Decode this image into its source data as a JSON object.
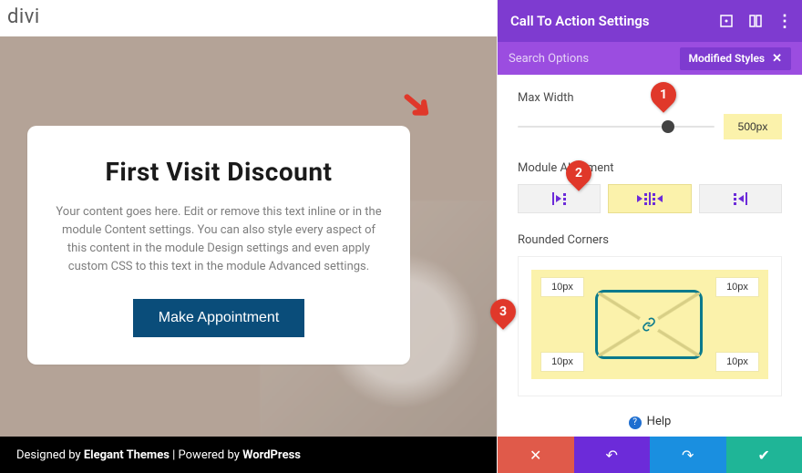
{
  "logo": "divi",
  "card": {
    "title": "First Visit Discount",
    "body": "Your content goes here. Edit or remove this text inline or in the module Content settings. You can also style every aspect of this content in the module Design settings and even apply custom CSS to this text in the module Advanced settings.",
    "button": "Make Appointment"
  },
  "footer": {
    "prefix": "Designed by ",
    "brand": "Elegant Themes",
    "mid": " | Powered by ",
    "platform": "WordPress"
  },
  "panel": {
    "title": "Call To Action Settings",
    "search_label": "Search Options",
    "pill": "Modified Styles",
    "max_width": {
      "label": "Max Width",
      "value": "500px"
    },
    "alignment": {
      "label": "Module Alignment",
      "selected": "center"
    },
    "rounded": {
      "label": "Rounded Corners",
      "tl": "10px",
      "tr": "10px",
      "bl": "10px",
      "br": "10px"
    },
    "help": "Help"
  },
  "badges": {
    "b1": "1",
    "b2": "2",
    "b3": "3"
  }
}
